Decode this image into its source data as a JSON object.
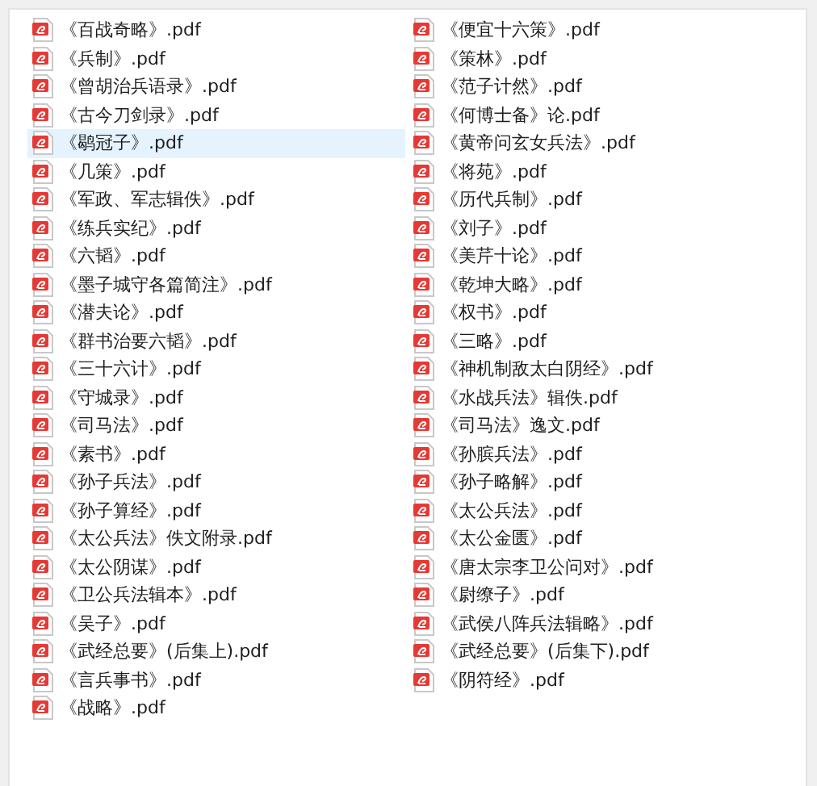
{
  "files": [
    {
      "name": "《百战奇略》.pdf",
      "selected": false
    },
    {
      "name": "《兵制》.pdf",
      "selected": false
    },
    {
      "name": "《曾胡治兵语录》.pdf",
      "selected": false
    },
    {
      "name": "《古今刀剑录》.pdf",
      "selected": false
    },
    {
      "name": "《鹖冠子》.pdf",
      "selected": true
    },
    {
      "name": "《几策》.pdf",
      "selected": false
    },
    {
      "name": "《军政、军志辑佚》.pdf",
      "selected": false
    },
    {
      "name": "《练兵实纪》.pdf",
      "selected": false
    },
    {
      "name": "《六韬》.pdf",
      "selected": false
    },
    {
      "name": "《墨子城守各篇简注》.pdf",
      "selected": false
    },
    {
      "name": "《潜夫论》.pdf",
      "selected": false
    },
    {
      "name": "《群书治要六韬》.pdf",
      "selected": false
    },
    {
      "name": "《三十六计》.pdf",
      "selected": false
    },
    {
      "name": "《守城录》.pdf",
      "selected": false
    },
    {
      "name": "《司马法》.pdf",
      "selected": false
    },
    {
      "name": "《素书》.pdf",
      "selected": false
    },
    {
      "name": "《孙子兵法》.pdf",
      "selected": false
    },
    {
      "name": "《孙子算经》.pdf",
      "selected": false
    },
    {
      "name": "《太公兵法》佚文附录.pdf",
      "selected": false
    },
    {
      "name": "《太公阴谋》.pdf",
      "selected": false
    },
    {
      "name": "《卫公兵法辑本》.pdf",
      "selected": false
    },
    {
      "name": "《吴子》.pdf",
      "selected": false
    },
    {
      "name": "《武经总要》(后集上).pdf",
      "selected": false
    },
    {
      "name": "《言兵事书》.pdf",
      "selected": false
    },
    {
      "name": "《战略》.pdf",
      "selected": false
    },
    {
      "name": "《便宜十六策》.pdf",
      "selected": false
    },
    {
      "name": "《策林》.pdf",
      "selected": false
    },
    {
      "name": "《范子计然》.pdf",
      "selected": false
    },
    {
      "name": "《何博士备》论.pdf",
      "selected": false
    },
    {
      "name": "《黄帝问玄女兵法》.pdf",
      "selected": false
    },
    {
      "name": "《将苑》.pdf",
      "selected": false
    },
    {
      "name": "《历代兵制》.pdf",
      "selected": false
    },
    {
      "name": "《刘子》.pdf",
      "selected": false
    },
    {
      "name": "《美芹十论》.pdf",
      "selected": false
    },
    {
      "name": "《乾坤大略》.pdf",
      "selected": false
    },
    {
      "name": "《权书》.pdf",
      "selected": false
    },
    {
      "name": "《三略》.pdf",
      "selected": false
    },
    {
      "name": "《神机制敌太白阴经》.pdf",
      "selected": false
    },
    {
      "name": "《水战兵法》辑佚.pdf",
      "selected": false
    },
    {
      "name": "《司马法》逸文.pdf",
      "selected": false
    },
    {
      "name": "《孙膑兵法》.pdf",
      "selected": false
    },
    {
      "name": "《孙子略解》.pdf",
      "selected": false
    },
    {
      "name": "《太公兵法》.pdf",
      "selected": false
    },
    {
      "name": "《太公金匮》.pdf",
      "selected": false
    },
    {
      "name": "《唐太宗李卫公问对》.pdf",
      "selected": false
    },
    {
      "name": "《尉缭子》.pdf",
      "selected": false
    },
    {
      "name": "《武侯八阵兵法辑略》.pdf",
      "selected": false
    },
    {
      "name": "《武经总要》(后集下).pdf",
      "selected": false
    },
    {
      "name": "《阴符经》.pdf",
      "selected": false
    }
  ]
}
